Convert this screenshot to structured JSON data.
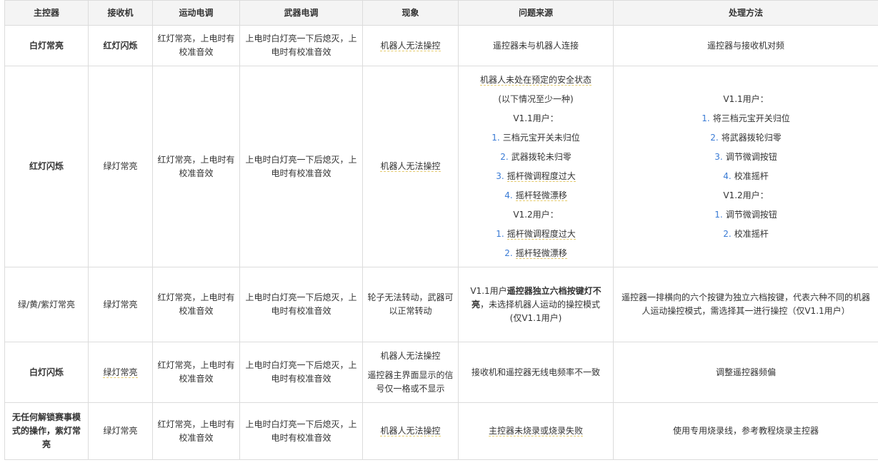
{
  "headers": [
    "主控器",
    "接收机",
    "运动电调",
    "武器电调",
    "现象",
    "问题来源",
    "处理方法"
  ],
  "row1": {
    "main": "白灯常亮",
    "receiver": "红灯闪烁",
    "motor": "红灯常亮，上电时有校准音效",
    "weapon": "上电时白灯亮一下后熄灭，上电时有校准音效",
    "phenomenon": "机器人无法操控",
    "source": "遥控器未与机器人连接",
    "solution": "遥控器与接收机对频"
  },
  "row2": {
    "main": "红灯闪烁",
    "receiver": "绿灯常亮",
    "motor": "红灯常亮，上电时有校准音效",
    "weapon": "上电时白灯亮一下后熄灭，上电时有校准音效",
    "phenomenon": "机器人无法操控",
    "source": {
      "line1": "机器人未处在预定的安全状态",
      "line2": "(以下情况至少一种)",
      "v11": "V1.1用户：",
      "v11_items": [
        "三档元宝开关未归位",
        "武器拨轮未归零",
        "摇杆微调程度过大",
        "摇杆轻微漂移"
      ],
      "v12": "V1.2用户：",
      "v12_items": [
        "摇杆微调程度过大",
        "摇杆轻微漂移"
      ]
    },
    "solution": {
      "v11": "V1.1用户：",
      "v11_items": [
        "将三档元宝开关归位",
        "将武器拨轮归零",
        "调节微调按钮",
        "校准摇杆"
      ],
      "v12": "V1.2用户：",
      "v12_items": [
        "调节微调按钮",
        "校准摇杆"
      ]
    },
    "nums": [
      "1.",
      "2.",
      "3.",
      "4."
    ]
  },
  "row3": {
    "main": "绿/黄/紫灯常亮",
    "receiver": "绿灯常亮",
    "motor": "红灯常亮，上电时有校准音效",
    "weapon": "上电时白灯亮一下后熄灭，上电时有校准音效",
    "phenomenon": "轮子无法转动，武器可以正常转动",
    "source_a": "V1.1用户",
    "source_b": "遥控器独立六档按键灯不亮",
    "source_c": "，未选择机器人运动的操控模式",
    "source_d": "(仅V1.1用户)",
    "solution": "遥控器一排横向的六个按键为独立六档按键，代表六种不同的机器人运动操控模式，需选择其一进行操控（仅V1.1用户）"
  },
  "row4": {
    "main": "白灯闪烁",
    "receiver": "绿灯常亮",
    "motor": "红灯常亮，上电时有校准音效",
    "weapon": "上电时白灯亮一下后熄灭，上电时有校准音效",
    "phenomenon_1": "机器人无法操控",
    "phenomenon_2": "遥控器主界面显示的信号仅一格或不显示",
    "source": "接收机和遥控器无线电频率不一致",
    "solution": "调整遥控器频偏"
  },
  "row5": {
    "main": "无任何解锁赛事模式的操作，紫灯常亮",
    "receiver": "绿灯常亮",
    "motor": "红灯常亮，上电时有校准音效",
    "weapon": "上电时白灯亮一下后熄灭，上电时有校准音效",
    "phenomenon": "机器人无法操控",
    "source": "主控器未烧录或烧录失败",
    "solution": "使用专用烧录线，参考教程烧录主控器"
  }
}
